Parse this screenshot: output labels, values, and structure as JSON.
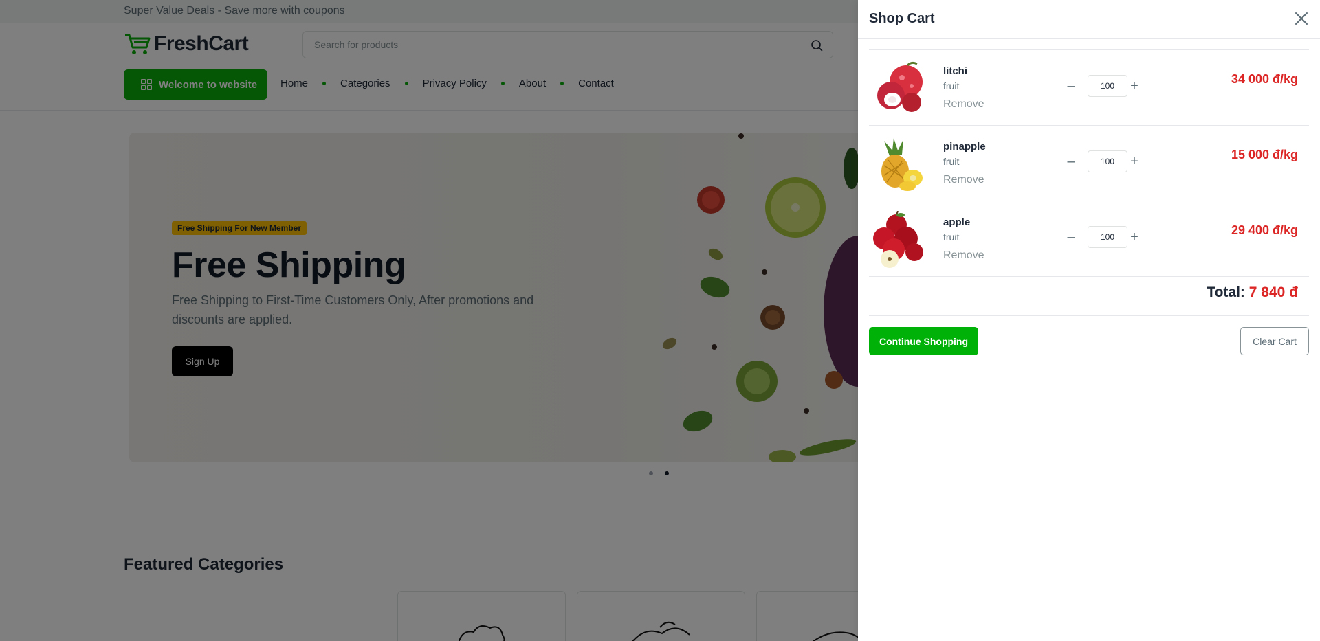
{
  "topbar": {
    "text": "Super Value Deals - Save more with coupons"
  },
  "logo": {
    "text": "FreshCart"
  },
  "search": {
    "placeholder": "Search for products"
  },
  "welcome_button": {
    "label": "Welcome to website"
  },
  "nav": {
    "items": [
      {
        "label": "Home"
      },
      {
        "label": "Categories"
      },
      {
        "label": "Privacy Policy"
      },
      {
        "label": "About"
      },
      {
        "label": "Contact"
      }
    ]
  },
  "hero": {
    "badge": "Free Shipping For New Member",
    "title": "Free Shipping",
    "description": "Free Shipping to First-Time Customers Only, After promotions and discounts are applied.",
    "button": "Sign Up",
    "slide_count": 2,
    "active_slide": 2
  },
  "featured": {
    "title": "Featured Categories"
  },
  "cart": {
    "title": "Shop Cart",
    "items": [
      {
        "name": "litchi",
        "category": "fruit",
        "remove": "Remove",
        "quantity": "100",
        "price": "34 000 đ/kg",
        "image": "litchi-image"
      },
      {
        "name": "pinapple",
        "category": "fruit",
        "remove": "Remove",
        "quantity": "100",
        "price": "15 000 đ/kg",
        "image": "pineapple-image"
      },
      {
        "name": "apple",
        "category": "fruit",
        "remove": "Remove",
        "quantity": "100",
        "price": "29 400 đ/kg",
        "image": "apple-image"
      }
    ],
    "total_label": "Total:",
    "total_value": "7 840 đ",
    "continue_label": "Continue Shopping",
    "clear_label": "Clear Cart"
  },
  "colors": {
    "brand_green": "#0aad0a",
    "price_red": "#dc2626",
    "badge_yellow": "#ffc107"
  }
}
